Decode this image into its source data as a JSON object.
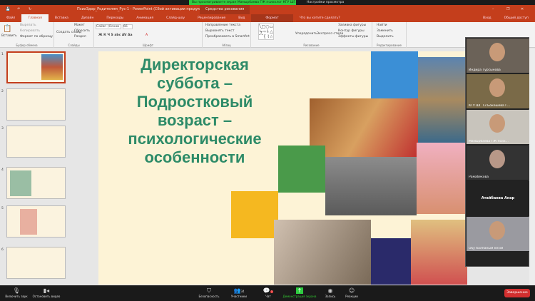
{
  "zoom_notice": "Вы просматриваете экран Мамырбаева ГЖ психолог КГУ ШГ...",
  "view_options": "Настройки просмотра",
  "app_title": "ПсихЗдор_Родителям_Рус-1 - PowerPoint (Сбой активации продукта)",
  "drawing_tools": "Средства рисования",
  "signin": "Вход",
  "share": "Общий доступ",
  "tell_me": "Что вы хотите сделать?",
  "tabs": [
    "Файл",
    "Главная",
    "Вставка",
    "Дизайн",
    "Переходы",
    "Анимация",
    "Слайд-шоу",
    "Рецензирование",
    "Вид",
    "Формат"
  ],
  "ribbon": {
    "paste": "Вставить",
    "cut": "Вырезать",
    "copy": "Копировать",
    "format_painter": "Формат по образцу",
    "clipboard": "Буфер обмена",
    "new_slide": "Создать слайд",
    "layout": "Макет",
    "reset": "Сбросить",
    "section": "Раздел",
    "slides": "Слайды",
    "font_name": "Calibri (Основ",
    "font_size": "66",
    "font": "Шрифт",
    "text_direction": "Направление текста",
    "align_text": "Выровнять текст",
    "smartart": "Преобразовать в SmartArt",
    "paragraph": "Абзац",
    "arrange": "Упорядочить",
    "quick_styles": "Экспресс-стили",
    "shape_fill": "Заливка фигуры",
    "shape_outline": "Контур фигуры",
    "shape_effects": "Эффекты фигуры",
    "drawing": "Рисование",
    "find": "Найти",
    "replace": "Заменить",
    "select": "Выделить",
    "editing": "Редактирование"
  },
  "slide_numbers": [
    "1",
    "2",
    "3",
    "4",
    "5",
    "6"
  ],
  "slide": {
    "title": "Директорская суббота – Подростковый возраст – психологические особенности"
  },
  "participants": [
    "Индира Турсынова",
    "КГУ ШГ ТЗ Бокешева Г...",
    "Мамырбаева ГЖ псих...",
    "Рамабекова",
    "Атайбаева Анар",
    "Оқу балпаным кезім"
  ],
  "bottom": {
    "unmute": "Включить звук",
    "start_video": "Остановить видео",
    "security": "Безопасность",
    "participants": "Участники",
    "participants_count": "34",
    "chat": "Чат",
    "chat_badge": "1",
    "share_screen": "Демонстрация экрана",
    "record": "Запись",
    "reactions": "Реакции",
    "end": "Завершение"
  },
  "colors": {
    "ppt_red": "#c43e1c",
    "title_green": "#2e8b68",
    "share_green": "#2ecc40",
    "end_red": "#d32f2f"
  }
}
